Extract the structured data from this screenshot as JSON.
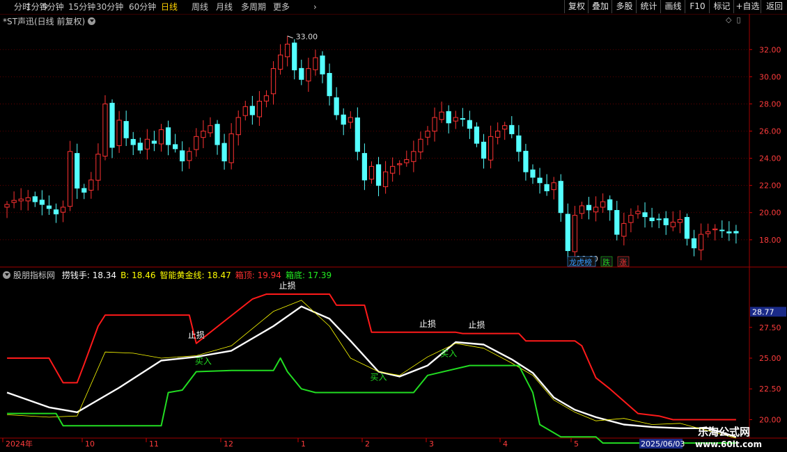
{
  "toolbar": {
    "periods": [
      {
        "label": "分时",
        "active": false
      },
      {
        "label": "1分钟",
        "active": false
      },
      {
        "label": "5分钟",
        "active": false
      },
      {
        "label": "15分钟",
        "active": false
      },
      {
        "label": "30分钟",
        "active": false
      },
      {
        "label": "60分钟",
        "active": false
      },
      {
        "label": "日线",
        "active": true
      },
      {
        "label": "周线",
        "active": false
      },
      {
        "label": "月线",
        "active": false
      },
      {
        "label": "多周期",
        "active": false
      },
      {
        "label": "更多",
        "active": false
      }
    ],
    "buttons": [
      "复权",
      "叠加",
      "多股",
      "统计",
      "画线",
      "F10",
      "标记",
      "+自选",
      "返回"
    ]
  },
  "price_panel": {
    "title": "*ST声迅(日线 前复权)",
    "high_label": "33.00",
    "low_label": "16.60",
    "tags": [
      {
        "text": "龙虎榜",
        "color": "#3399ff"
      },
      {
        "text": "跌",
        "color": "#22cc22"
      },
      {
        "text": "涨",
        "color": "#ff3333"
      }
    ]
  },
  "indicator_panel": {
    "name": "股朋指标网",
    "values": [
      {
        "label": "捞钱手:",
        "value": "18.34",
        "color": "#ffffff"
      },
      {
        "label": "B:",
        "value": "18.46",
        "color": "#ffff00"
      },
      {
        "label": "智能黄金线:",
        "value": "18.47",
        "color": "#ffff00"
      },
      {
        "label": "箱顶:",
        "value": "19.94",
        "color": "#ff3030"
      },
      {
        "label": "箱底:",
        "value": "17.39",
        "color": "#22ee22"
      }
    ],
    "current_price_tag": "28.77",
    "stop_loss_text": "止损",
    "buy_text": "买入"
  },
  "x_axis": {
    "labels": [
      "2024年",
      "10",
      "11",
      "12",
      "1",
      "2",
      "3",
      "4",
      "5"
    ],
    "highlight_date": "2025/06/03"
  },
  "watermark": {
    "line1": "乐淘公式网",
    "line2": "www.60lt.com"
  },
  "colors": {
    "up": "#ff3232",
    "down": "#54ffff",
    "box_top": "#ff1a1a",
    "box_bottom": "#22dd22",
    "money_line": "#ffffff",
    "gold_line": "#ffff00",
    "grid": "#7a0000",
    "axis_text": "#ff3c3c"
  },
  "chart_data": [
    {
      "type": "candlestick",
      "title": "*ST声迅(日线 前复权)",
      "xlabel": "",
      "ylabel": "",
      "ylim": [
        16.2,
        33.6
      ],
      "y_ticks": [
        18.0,
        20.0,
        22.0,
        24.0,
        26.0,
        28.0,
        30.0,
        32.0
      ],
      "x_tick_labels": [
        "2024年",
        "10",
        "11",
        "12",
        "1",
        "2",
        "3",
        "4",
        "5"
      ],
      "grid": true,
      "annotations": [
        {
          "text": "33.00",
          "value": 33.0
        },
        {
          "text": "16.60",
          "value": 16.6
        }
      ],
      "close_series": [
        20.6,
        20.9,
        21.0,
        21.1,
        20.8,
        20.6,
        20.3,
        19.9,
        20.4,
        24.5,
        21.8,
        21.5,
        22.4,
        24.3,
        28.0,
        24.8,
        26.8,
        25.5,
        25.0,
        24.6,
        25.4,
        25.1,
        26.1,
        25.0,
        24.7,
        23.8,
        24.5,
        25.6,
        26.0,
        26.4,
        25.0,
        23.8,
        25.8,
        27.0,
        27.8,
        27.2,
        28.2,
        28.6,
        30.6,
        31.6,
        32.4,
        30.5,
        29.8,
        30.6,
        31.4,
        30.2,
        28.6,
        27.2,
        26.5,
        27.0,
        24.5,
        22.4,
        23.4,
        22.0,
        23.0,
        23.4,
        23.6,
        23.9,
        24.5,
        25.4,
        26.0,
        27.0,
        27.4,
        26.6,
        27.0,
        26.9,
        26.2,
        25.1,
        24.0,
        25.6,
        26.0,
        26.4,
        25.8,
        24.5,
        23.0,
        22.6,
        22.2,
        21.6,
        22.2,
        20.0,
        17.2,
        19.8,
        20.5,
        20.2,
        20.4,
        20.8,
        20.2,
        18.4,
        19.2,
        19.8,
        20.1,
        19.7,
        19.4,
        19.5,
        19.1,
        19.3,
        19.5,
        18.1,
        17.4,
        18.4,
        18.6,
        18.8,
        18.7,
        18.5,
        18.5
      ]
    },
    {
      "type": "line",
      "title": "股朋指标网",
      "xlabel": "",
      "ylabel": "",
      "ylim": [
        18.5,
        31.5
      ],
      "y_ticks": [
        20.0,
        22.5,
        25.0,
        27.5
      ],
      "series": [
        {
          "name": "捞钱手",
          "color": "#ffffff",
          "x": [
            0,
            6,
            10,
            16,
            22,
            27,
            32,
            38,
            42,
            46,
            49,
            53,
            56,
            60,
            64,
            68,
            72,
            75,
            78,
            81,
            84,
            88,
            92,
            96,
            100,
            104
          ],
          "values": [
            22.2,
            21.0,
            20.6,
            22.6,
            24.8,
            25.1,
            25.6,
            27.6,
            29.2,
            28.2,
            26.4,
            23.9,
            23.5,
            24.4,
            26.3,
            26.1,
            24.9,
            23.8,
            21.8,
            20.8,
            20.2,
            19.6,
            19.4,
            19.3,
            19.3,
            18.6
          ]
        },
        {
          "name": "智能黄金线",
          "color": "#ffff00",
          "x": [
            0,
            6,
            10,
            14,
            18,
            22,
            27,
            32,
            38,
            42,
            46,
            49,
            53,
            56,
            60,
            64,
            68,
            72,
            75,
            78,
            81,
            84,
            88,
            92,
            96,
            100,
            104
          ],
          "values": [
            20.4,
            20.2,
            20.3,
            25.5,
            25.4,
            25.0,
            25.2,
            26.0,
            28.8,
            29.7,
            27.6,
            25.0,
            23.9,
            23.6,
            25.1,
            26.2,
            25.8,
            24.6,
            23.6,
            21.6,
            20.6,
            19.9,
            20.1,
            19.6,
            19.7,
            19.1,
            18.5
          ]
        },
        {
          "name": "箱顶",
          "color": "#ff1a1a",
          "x": [
            0,
            6,
            8,
            10,
            11,
            13,
            14,
            26,
            27,
            31,
            35,
            37,
            46,
            47,
            51,
            52,
            63,
            64,
            65,
            73,
            74,
            81,
            82,
            84,
            86,
            88,
            90,
            93,
            95,
            100,
            104
          ],
          "values": [
            25.0,
            25.0,
            23.0,
            23.0,
            24.5,
            27.6,
            28.5,
            28.5,
            26.2,
            28.0,
            29.8,
            30.2,
            30.2,
            29.3,
            29.3,
            27.1,
            27.1,
            27.1,
            27.0,
            27.0,
            26.4,
            26.4,
            26.0,
            23.4,
            22.5,
            21.5,
            20.5,
            20.3,
            20.0,
            20.0,
            20.0
          ]
        },
        {
          "name": "箱底",
          "color": "#22dd22",
          "x": [
            0,
            7,
            8,
            22,
            23,
            25,
            27,
            32,
            38,
            39,
            40,
            42,
            44,
            52,
            54,
            58,
            60,
            66,
            68,
            73,
            75,
            76,
            79,
            81,
            84,
            85,
            88,
            96,
            98,
            104
          ],
          "values": [
            20.5,
            20.5,
            19.5,
            19.5,
            22.2,
            22.4,
            23.9,
            24.0,
            24.0,
            25.0,
            23.9,
            22.5,
            22.2,
            22.2,
            22.2,
            22.2,
            23.6,
            24.4,
            24.4,
            24.4,
            22.2,
            19.6,
            18.6,
            18.6,
            18.6,
            18.1,
            18.1,
            18.1,
            18.1,
            18.1
          ]
        }
      ],
      "signals": [
        {
          "type": "止损",
          "x": 27
        },
        {
          "type": "止损",
          "x": 40
        },
        {
          "type": "止损",
          "x": 60
        },
        {
          "type": "止损",
          "x": 67
        },
        {
          "type": "买入",
          "x": 28
        },
        {
          "type": "买入",
          "x": 53
        },
        {
          "type": "买入",
          "x": 63
        }
      ]
    }
  ]
}
